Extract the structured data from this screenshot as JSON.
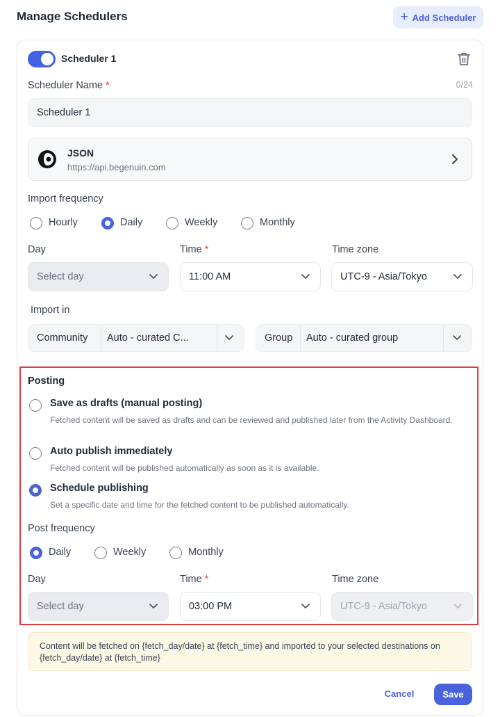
{
  "header": {
    "title": "Manage Schedulers",
    "add_button": "Add Scheduler"
  },
  "scheduler": {
    "enabled": true,
    "title": "Scheduler 1",
    "name_label": "Scheduler Name",
    "required_mark": "*",
    "name_counter": "0/24",
    "name_value": "Scheduler 1",
    "source": {
      "name": "JSON",
      "url": "https://api.begenuin.com"
    },
    "import": {
      "frequency_label": "Import frequency",
      "frequency_options": [
        "Hourly",
        "Daily",
        "Weekly",
        "Monthly"
      ],
      "selected_frequency": "Daily",
      "day_label": "Day",
      "day_placeholder": "Select day",
      "time_label": "Time",
      "time_value": "11:00 AM",
      "timezone_label": "Time zone",
      "timezone_value": "UTC-9 - Asia/Tokyo",
      "import_in_label": "Import in",
      "community_label": "Community",
      "community_value": "Auto - curated C...",
      "group_label": "Group",
      "group_value": "Auto - curated group"
    },
    "posting": {
      "title": "Posting",
      "options": [
        {
          "title": "Save as drafts (manual posting)",
          "desc": "Fetched content will be saved as drafts and can be reviewed and published later from the Activity Dashboard.",
          "selected": false
        },
        {
          "title": "Auto publish immediately",
          "desc": "Fetched content will be published automatically as soon as it is available.",
          "selected": false
        },
        {
          "title": "Schedule publishing",
          "desc": "Set a specific date and time for the fetched content to be published automatically.",
          "selected": true
        }
      ],
      "post_frequency_label": "Post frequency",
      "post_frequency_options": [
        "Daily",
        "Weekly",
        "Monthly"
      ],
      "selected_post_frequency": "Daily",
      "day_label": "Day",
      "day_placeholder": "Select day",
      "time_label": "Time",
      "time_value": "03:00 PM",
      "timezone_label": "Time zone",
      "timezone_value": "UTC-9 - Asia/Tokyo"
    },
    "note": "Content will be fetched on {fetch_day/date} at {fetch_time} and  imported to your selected destinations on {fetch_day/date} at {fetch_time}"
  },
  "footer": {
    "cancel": "Cancel",
    "save": "Save"
  },
  "colors": {
    "accent": "#4a63dc",
    "highlight_border": "#e0393e",
    "note_bg": "#fdf8e6"
  }
}
